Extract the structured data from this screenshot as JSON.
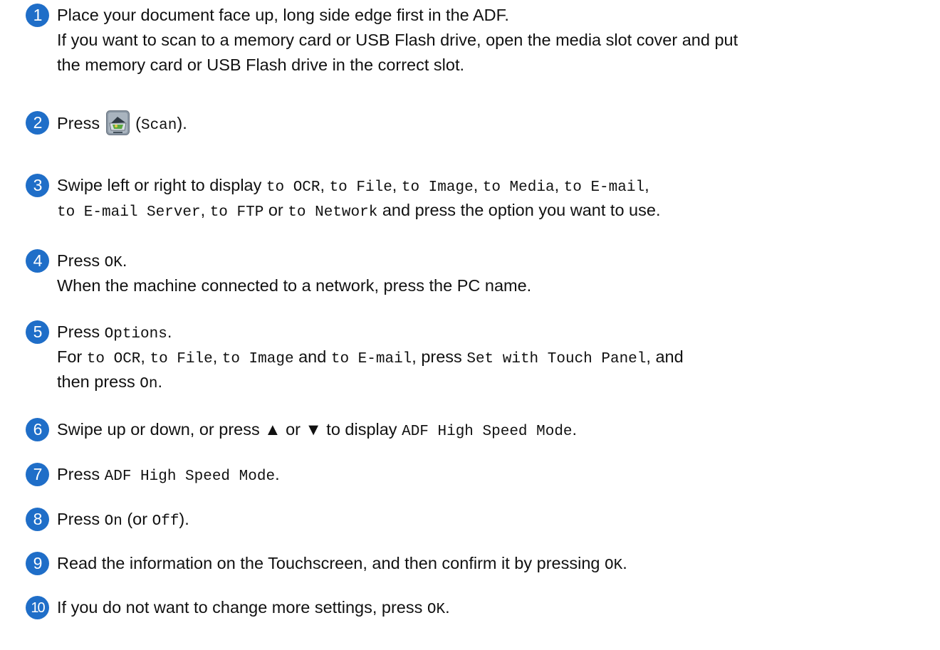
{
  "steps": [
    {
      "number": "1",
      "line1": "Place your document face up, long side edge first in the ADF.",
      "line2": "If you want to scan to a memory card or USB Flash drive, open the media slot cover and put",
      "line3": "the memory card or USB Flash drive in the correct slot."
    },
    {
      "number": "2",
      "t1": "Press ",
      "t2": " (",
      "k1": "Scan",
      "t3": ").",
      "icon": "scan-icon"
    },
    {
      "number": "3",
      "t1": "Swipe left or right to display ",
      "k1": "to OCR",
      "s1": ", ",
      "k2": "to File",
      "s2": ", ",
      "k3": "to Image",
      "s3": ", ",
      "k4": "to Media",
      "s4": ", ",
      "k5": "to E-mail",
      "s5": ",",
      "k6": "to E-mail Server",
      "s6": ", ",
      "k7": "to FTP",
      "s7": " or ",
      "k8": "to Network",
      "t2": " and press the option you want to use."
    },
    {
      "number": "4",
      "t1": "Press ",
      "k1": "OK",
      "t2": ".",
      "line2": "When the machine connected to a network, press the PC name."
    },
    {
      "number": "5",
      "t1": "Press ",
      "k1": "Options",
      "t2": ".",
      "l2a": "For ",
      "k2": "to OCR",
      "l2b": ", ",
      "k3": "to File",
      "l2c": ", ",
      "k4": "to Image",
      "l2d": " and ",
      "k5": "to E-mail",
      "l2e": ", press ",
      "k6": "Set with Touch Panel",
      "l2f": ", and",
      "l3a": "then press ",
      "k7": "On",
      "l3b": "."
    },
    {
      "number": "6",
      "t1": "Swipe up or down, or press ▲ or ▼ to display ",
      "k1": "ADF High Speed Mode",
      "t2": "."
    },
    {
      "number": "7",
      "t1": "Press ",
      "k1": "ADF High Speed Mode",
      "t2": "."
    },
    {
      "number": "8",
      "t1": "Press ",
      "k1": "On",
      "t2": " (or ",
      "k2": "Off",
      "t3": ")."
    },
    {
      "number": "9",
      "t1": "Read the information on the Touchscreen, and then confirm it by pressing ",
      "k1": "OK",
      "t2": "."
    },
    {
      "number": "10",
      "t1": "If you do not want to change more settings, press ",
      "k1": "OK",
      "t2": "."
    }
  ],
  "colors": {
    "step_circle": "#1f6ec8",
    "text": "#111111"
  }
}
